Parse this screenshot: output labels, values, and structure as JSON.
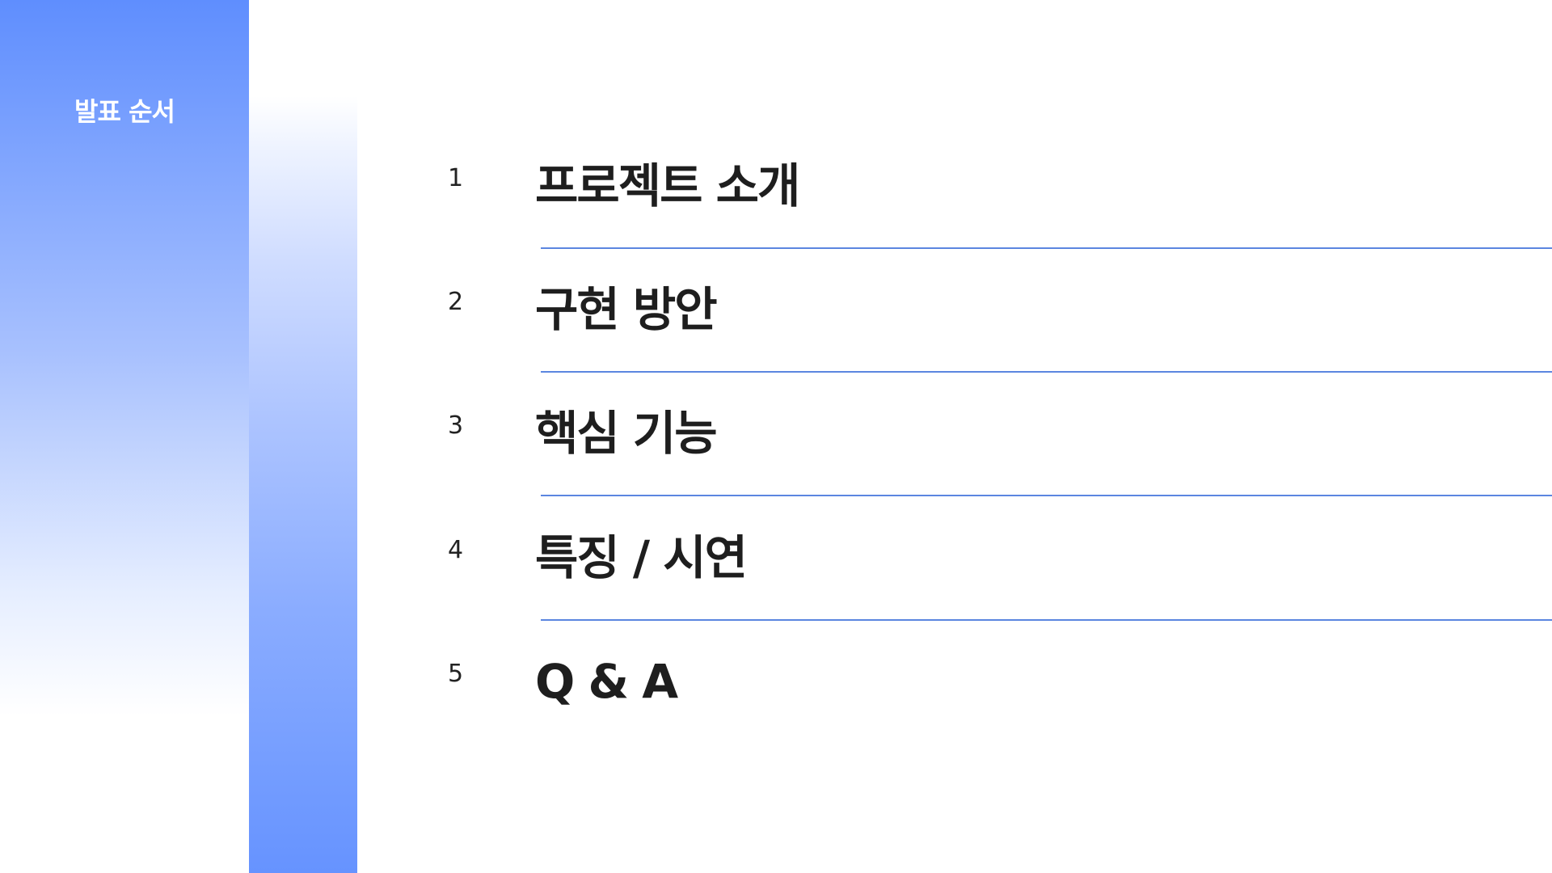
{
  "sidebar": {
    "title": "발표 순서"
  },
  "agenda": {
    "items": [
      {
        "number": "1",
        "title": "프로젝트 소개"
      },
      {
        "number": "2",
        "title": "구현 방안"
      },
      {
        "number": "3",
        "title": "핵심 기능"
      },
      {
        "number": "4",
        "title": "특징 / 시연"
      },
      {
        "number": "5",
        "title": "Q & A"
      }
    ]
  },
  "colors": {
    "accent": "#5f8efe",
    "divider": "#5b86e0",
    "text": "#1e1e1e"
  }
}
